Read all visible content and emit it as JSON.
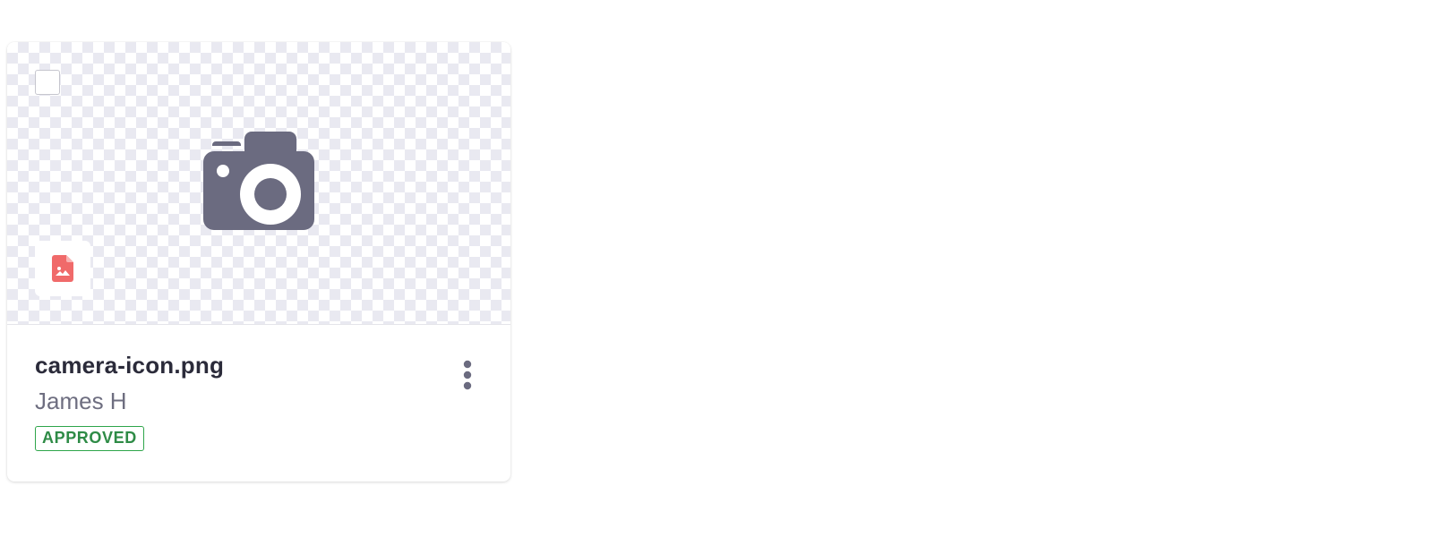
{
  "asset_card": {
    "filename": "camera-icon.png",
    "owner": "James H",
    "status": "APPROVED",
    "preview_icon": "camera-icon",
    "filetype_icon": "image-file-icon",
    "selected": false,
    "colors": {
      "icon": "#6b6b80",
      "filetype_badge": "#f06a6a",
      "status": "#2e8b46"
    }
  }
}
